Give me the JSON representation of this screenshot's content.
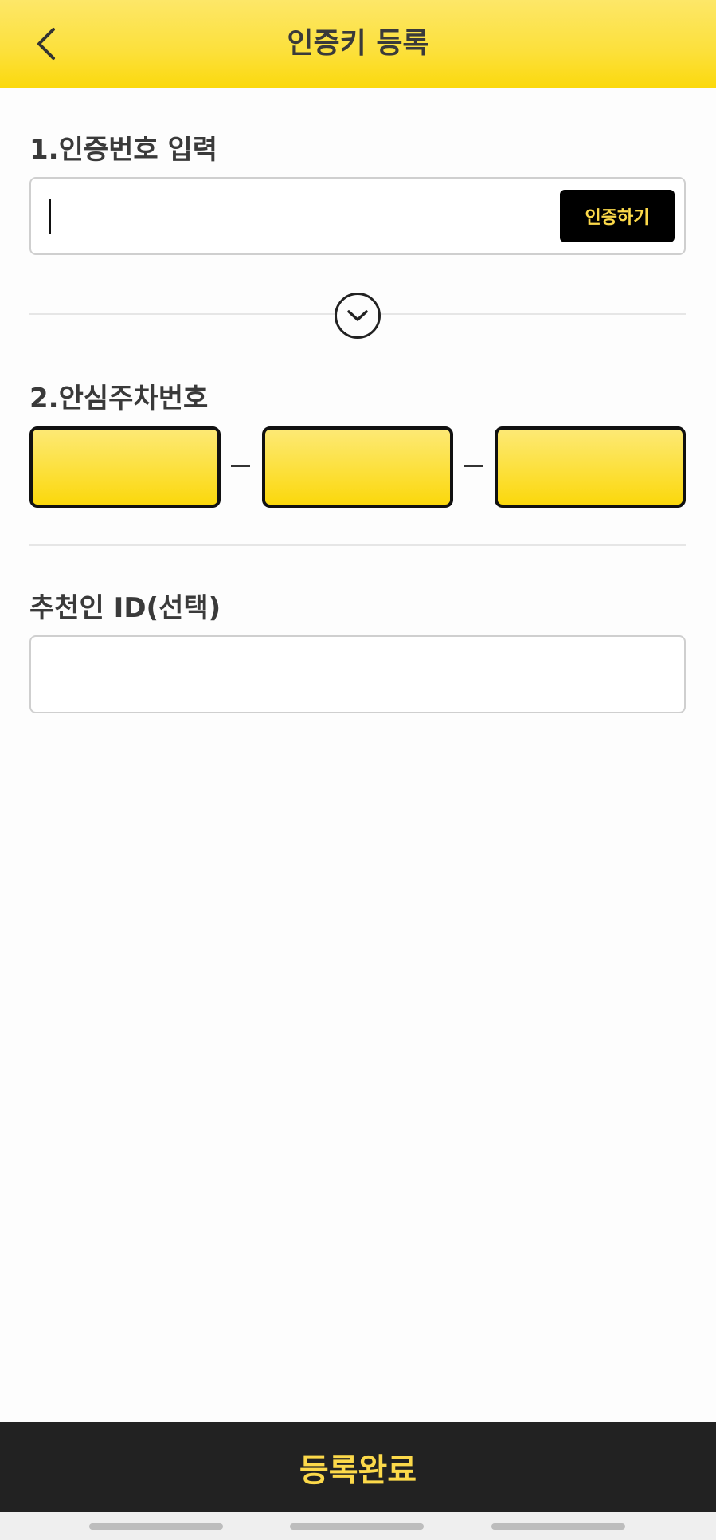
{
  "header": {
    "title": "인증키 등록",
    "back_icon": "chevron-left-icon"
  },
  "section1": {
    "title": "1.인증번호 입력",
    "input_value": "",
    "verify_label": "인증하기"
  },
  "toggle": {
    "icon": "chevron-down-circle-icon"
  },
  "section2": {
    "title": "2.안심주차번호",
    "parts": [
      "",
      "",
      ""
    ]
  },
  "section3": {
    "title": "추천인 ID(선택)",
    "input_value": ""
  },
  "submit": {
    "label": "등록완료"
  },
  "colors": {
    "accent_yellow": "#fce03a",
    "dark": "#222222",
    "button_text": "#fcd94a"
  }
}
